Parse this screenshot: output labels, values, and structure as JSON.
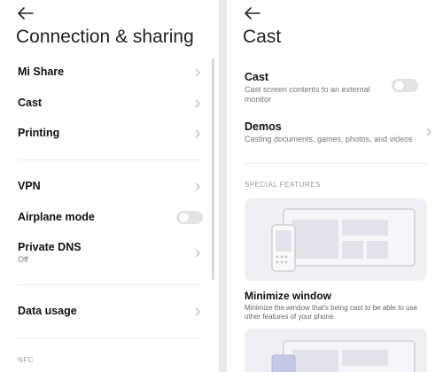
{
  "left": {
    "title": "Connection & sharing",
    "items": [
      {
        "label": "Mi Share"
      },
      {
        "label": "Cast"
      },
      {
        "label": "Printing"
      },
      {
        "label": "VPN"
      },
      {
        "label": "Airplane mode",
        "toggle": false
      },
      {
        "label": "Private DNS",
        "sub": "Off"
      },
      {
        "label": "Data usage"
      }
    ],
    "section_nfc": "NFC"
  },
  "right": {
    "title": "Cast",
    "cast": {
      "label": "Cast",
      "sub": "Cast screen contents to an external monitor",
      "toggle": false
    },
    "demos": {
      "label": "Demos",
      "sub": "Casting documents, games, photos, and videos"
    },
    "section_special": "SPECIAL FEATURES",
    "minimize": {
      "title": "Minimize window",
      "desc": "Minimize the window that's being cast to be able to use other features of your phone."
    }
  },
  "colors": {
    "background": "#e9e9ec",
    "panel": "#ffffff",
    "toggle_off": "#e3e3e6",
    "illustration_bg": "#eff0f4"
  },
  "icons": [
    "back-arrow-icon",
    "chevron-right-icon"
  ]
}
